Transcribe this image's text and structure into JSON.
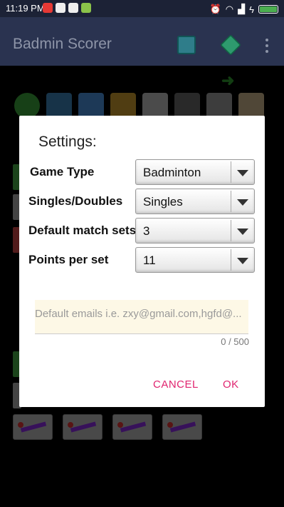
{
  "status_bar": {
    "time": "11:19 PM",
    "left_icons": [
      "notification-icon",
      "battery-saver-icon",
      "google-icon",
      "green-app-icon"
    ],
    "right_icons": [
      "alarm-icon",
      "wifi-icon",
      "signal-icon",
      "charging-icon",
      "battery-icon"
    ]
  },
  "app_bar": {
    "title": "Badmin Scorer",
    "actions": [
      "monitor-icon",
      "help-icon",
      "more-vert-icon"
    ]
  },
  "background": {
    "toolbar_icons": [
      "toggle-icon",
      "settings-icon",
      "font-icon",
      "undo-icon",
      "trash-icon",
      "stats-icon",
      "finish-flag-icon",
      "clipboard-icon"
    ],
    "player_icons": [
      "player-icon",
      "player-icon",
      "player-icon",
      "player-icon"
    ]
  },
  "dialog": {
    "title": "Settings:",
    "rows": [
      {
        "label": "Game Type",
        "value": "Badminton"
      },
      {
        "label": "Singles/Doubles",
        "value": "Singles"
      },
      {
        "label": "Default match sets",
        "value": "3"
      },
      {
        "label": "Points per set",
        "value": "11"
      }
    ],
    "email": {
      "placeholder": "Default emails i.e. zxy@gmail.com,hgfd@...",
      "value": "",
      "counter": "0 / 500"
    },
    "buttons": {
      "cancel": "CANCEL",
      "ok": "OK"
    }
  },
  "colors": {
    "accent": "#e0246f",
    "app_bar": "#2a3350",
    "status_bar": "#1c2236"
  }
}
